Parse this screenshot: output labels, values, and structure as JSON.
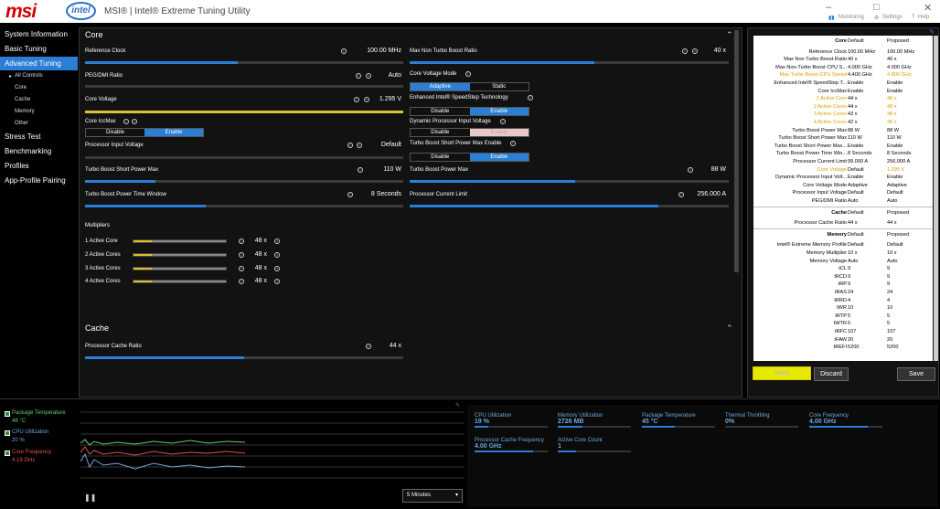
{
  "titlebar": {
    "brand": "msi",
    "intel": "intel",
    "title": "MSI® | Intel® Extreme Tuning Utility",
    "monitoring": "Monitoring",
    "settings": "Settings",
    "help": "Help"
  },
  "sidebar": {
    "items": [
      "System Information",
      "Basic Tuning",
      "Advanced Tuning",
      "All Controls",
      "Core",
      "Cache",
      "Memory",
      "Other",
      "Stress Test",
      "Benchmarking",
      "Profiles",
      "App-Profile Pairing"
    ]
  },
  "core": {
    "title": "Core",
    "reference_clock": {
      "label": "Reference Clock",
      "value": "100.00 MHz",
      "fill": 0.48
    },
    "max_non_turbo": {
      "label": "Max Non Turbo Boost Ratio",
      "value": "40 x",
      "fill": 0.58
    },
    "peg_dmi": {
      "label": "PEG/DMI Ratio",
      "value": "Auto",
      "fill": 0.0
    },
    "core_voltage_mode": {
      "label": "Core Voltage Mode",
      "options": [
        "Adaptive",
        "Static"
      ],
      "selected": "Adaptive"
    },
    "core_voltage": {
      "label": "Core Voltage",
      "value": "1.295 V",
      "fill": 1.0
    },
    "speedstep": {
      "label": "Enhanced Intel® SpeedStep Technology",
      "options": [
        "Disable",
        "Enable"
      ],
      "selected": "Enable"
    },
    "core_iccmax": {
      "label": "Core IccMax",
      "options": [
        "Disable",
        "Enable"
      ],
      "selected": "Enable"
    },
    "dyn_input_voltage": {
      "label": "Dynamic Processor Input Voltage",
      "options": [
        "Disable",
        "Enable"
      ],
      "selected": "Enable"
    },
    "proc_input_voltage": {
      "label": "Processor Input Voltage",
      "value": "Default"
    },
    "tb_short_enable": {
      "label": "Turbo Boost Short Power Max Enable",
      "options": [
        "Disable",
        "Enable"
      ],
      "selected": "Enable"
    },
    "tb_short_max": {
      "label": "Turbo Boost Short Power Max",
      "value": "110 W",
      "fill": 0.22
    },
    "tb_power_max": {
      "label": "Turbo Boost Power Max",
      "value": "88 W",
      "fill": 0.52
    },
    "tb_time_window": {
      "label": "Turbo Boost Power Time Window",
      "value": "8 Seconds",
      "fill": 0.38
    },
    "proc_current_limit": {
      "label": "Processor Current Limit",
      "value": "256.000 A",
      "fill": 0.78
    },
    "multipliers": {
      "label": "Multipliers",
      "rows": [
        {
          "label": "1 Active Core",
          "value": "48 x"
        },
        {
          "label": "2 Active Cores",
          "value": "48 x"
        },
        {
          "label": "3 Active Cores",
          "value": "48 x"
        },
        {
          "label": "4 Active Cores",
          "value": "48 x"
        }
      ]
    }
  },
  "cache": {
    "title": "Cache",
    "ratio": {
      "label": "Processor Cache Ratio",
      "value": "44 x",
      "fill": 0.5
    }
  },
  "summary": {
    "head": [
      "Core",
      "Default",
      "Proposed"
    ],
    "core_rows": [
      [
        "Reference Clock",
        "100.00 MHz",
        "100.00 MHz",
        false
      ],
      [
        "Max Non Turbo Boost Ratio",
        "40 x",
        "40 x",
        false
      ],
      [
        "Max Non-Turbo Boost CPU S...",
        "4.000 GHz",
        "4.000 GHz",
        false
      ],
      [
        "Max Turbo Boost CPU Speed",
        "4.400 GHz",
        "4.800 GHz",
        true
      ],
      [
        "Enhanced Intel® SpeedStep T...",
        "Enable",
        "Enable",
        false
      ],
      [
        "Core IccMax",
        "Enable",
        "Enable",
        false
      ],
      [
        "1 Active Core",
        "44 x",
        "48 x",
        true
      ],
      [
        "2 Active Cores",
        "44 x",
        "48 x",
        true
      ],
      [
        "3 Active Cores",
        "43 x",
        "48 x",
        true
      ],
      [
        "4 Active Cores",
        "42 x",
        "48 x",
        true
      ],
      [
        "Turbo Boost Power Max",
        "88 W",
        "88 W",
        false
      ],
      [
        "Turbo Boost Short Power Max",
        "110 W",
        "110 W",
        false
      ],
      [
        "Turbo Boost Short Power Max...",
        "Enable",
        "Enable",
        false
      ],
      [
        "Turbo Boost Power Time Win...",
        "8 Seconds",
        "8 Seconds",
        false
      ],
      [
        "Processor Current Limit",
        "99.000 A",
        "256.000 A",
        false
      ],
      [
        "Core Voltage",
        "Default",
        "1.295 V",
        true
      ],
      [
        "Dynamic Processor Input Volt...",
        "Enable",
        "Enable",
        false
      ],
      [
        "Core Voltage Mode",
        "Adaptive",
        "Adaptive",
        false
      ],
      [
        "Processor Input Voltage",
        "Default",
        "Default",
        false
      ],
      [
        "PEG/DMI Ratio",
        "Auto",
        "Auto",
        false
      ]
    ],
    "cache_head": [
      "Cache",
      "Default",
      "Proposed"
    ],
    "cache_rows": [
      [
        "Processor Cache Ratio",
        "44 x",
        "44 x",
        false
      ]
    ],
    "mem_head": [
      "Memory",
      "Default",
      "Proposed"
    ],
    "mem_rows": [
      [
        "Intel® Extreme Memory Profile",
        "Default",
        "Default",
        false
      ],
      [
        "Memory Multiplier",
        "10 x",
        "10 x",
        false
      ],
      [
        "Memory Voltage",
        "Auto",
        "Auto",
        false
      ],
      [
        "tCL",
        "9",
        "9",
        false
      ],
      [
        "tRCD",
        "9",
        "9",
        false
      ],
      [
        "tRP",
        "9",
        "9",
        false
      ],
      [
        "tRAS",
        "24",
        "24",
        false
      ],
      [
        "tRRD",
        "4",
        "4",
        false
      ],
      [
        "tWR",
        "10",
        "10",
        false
      ],
      [
        "tRTP",
        "5",
        "5",
        false
      ],
      [
        "tWTR",
        "5",
        "5",
        false
      ],
      [
        "tRFC",
        "107",
        "107",
        false
      ],
      [
        "tFAW",
        "20",
        "20",
        false
      ],
      [
        "tREFI",
        "5200",
        "5200",
        false
      ]
    ],
    "apply": "Apply",
    "discard": "Discard",
    "save": "Save"
  },
  "monitor": {
    "legend": [
      {
        "label": "Package Temperature",
        "value": "48 °C",
        "color": "#5fd068"
      },
      {
        "label": "CPU Utilization",
        "value": "20 %",
        "color": "#6fa8dc"
      },
      {
        "label": "Core Frequency",
        "value": "4.19 GHz",
        "color": "#e05050"
      }
    ],
    "interval": "5 Minutes",
    "tiles": [
      {
        "label": "CPU Utilization",
        "value": "19 %",
        "fill": 0.19
      },
      {
        "label": "Memory Utilization",
        "value": "2726  MB",
        "fill": 0.34
      },
      {
        "label": "Package Temperature",
        "value": "45 °C",
        "fill": 0.45
      },
      {
        "label": "Thermal Throttling",
        "value": "0%",
        "fill": 0.0
      },
      {
        "label": "Core Frequency",
        "value": "4.00 GHz",
        "fill": 0.8
      },
      {
        "label": "Processor Cache Frequency",
        "value": "4.00 GHz",
        "fill": 0.8
      },
      {
        "label": "Active Core Count",
        "value": "1",
        "fill": 0.25
      }
    ]
  }
}
